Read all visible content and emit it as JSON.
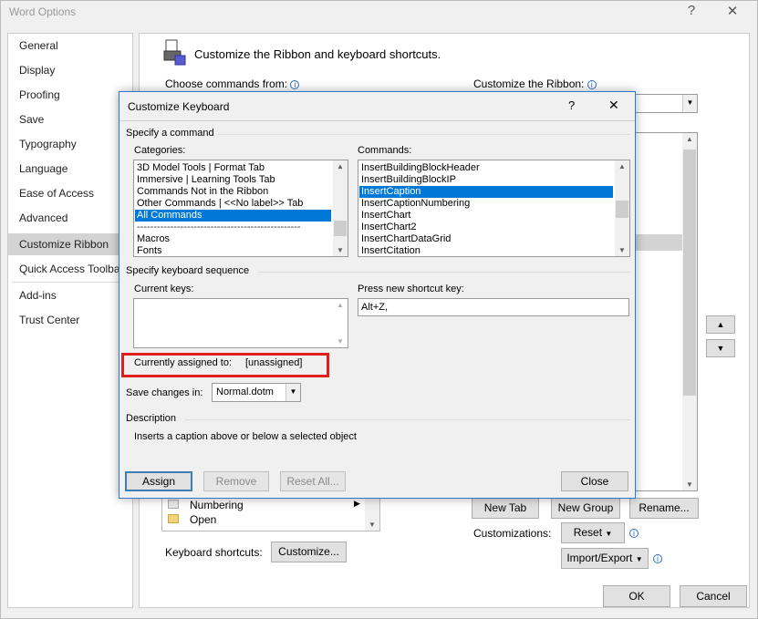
{
  "window": {
    "title": "Word Options",
    "help_glyph": "?",
    "close_glyph": "✕"
  },
  "nav": {
    "items": [
      "General",
      "Display",
      "Proofing",
      "Save",
      "Typography",
      "Language",
      "Ease of Access",
      "Advanced",
      "Customize Ribbon",
      "Quick Access Toolbar",
      "Add-ins",
      "Trust Center"
    ],
    "selected": "Customize Ribbon"
  },
  "main": {
    "heading": "Customize the Ribbon and keyboard shortcuts.",
    "choose_commands_label": "Choose commands from:",
    "customize_ribbon_label": "Customize the Ribbon:",
    "bg_list_items": [
      "Numbering",
      "Open"
    ],
    "keyboard_shortcuts_label": "Keyboard shortcuts:",
    "customize_button": "Customize...",
    "new_tab_button": "New Tab",
    "new_group_button": "New Group",
    "rename_button": "Rename...",
    "customizations_label": "Customizations:",
    "reset_button": "Reset",
    "import_export_button": "Import/Export",
    "ok_button": "OK",
    "cancel_button": "Cancel"
  },
  "dialog": {
    "title": "Customize Keyboard",
    "help_glyph": "?",
    "close_glyph": "✕",
    "specify_command": "Specify a command",
    "categories_label": "Categories:",
    "categories": [
      "3D Model Tools | Format Tab",
      "Immersive | Learning Tools Tab",
      "Commands Not in the Ribbon",
      "Other Commands | <<No label>> Tab",
      "All Commands",
      "-------------------------------------------------",
      "Macros",
      "Fonts"
    ],
    "categories_selected": "All Commands",
    "commands_label": "Commands:",
    "commands": [
      "InsertBuildingBlockHeader",
      "InsertBuildingBlockIP",
      "InsertCaption",
      "InsertCaptionNumbering",
      "InsertChart",
      "InsertChart2",
      "InsertChartDataGrid",
      "InsertCitation"
    ],
    "commands_selected": "InsertCaption",
    "specify_sequence": "Specify keyboard sequence",
    "current_keys_label": "Current keys:",
    "press_new_label": "Press new shortcut key:",
    "new_shortcut_value": "Alt+Z,",
    "currently_assigned_label": "Currently assigned to:",
    "currently_assigned_value": "[unassigned]",
    "save_changes_label": "Save changes in:",
    "save_changes_value": "Normal.dotm",
    "description_heading": "Description",
    "description_text": "Inserts a caption above or below a selected object",
    "assign_button": "Assign",
    "remove_button": "Remove",
    "reset_all_button": "Reset All...",
    "close_button": "Close"
  },
  "colors": {
    "selection": "#0078d7",
    "highlight_box": "#e01e1e",
    "dialog_border": "#2b79d0"
  }
}
